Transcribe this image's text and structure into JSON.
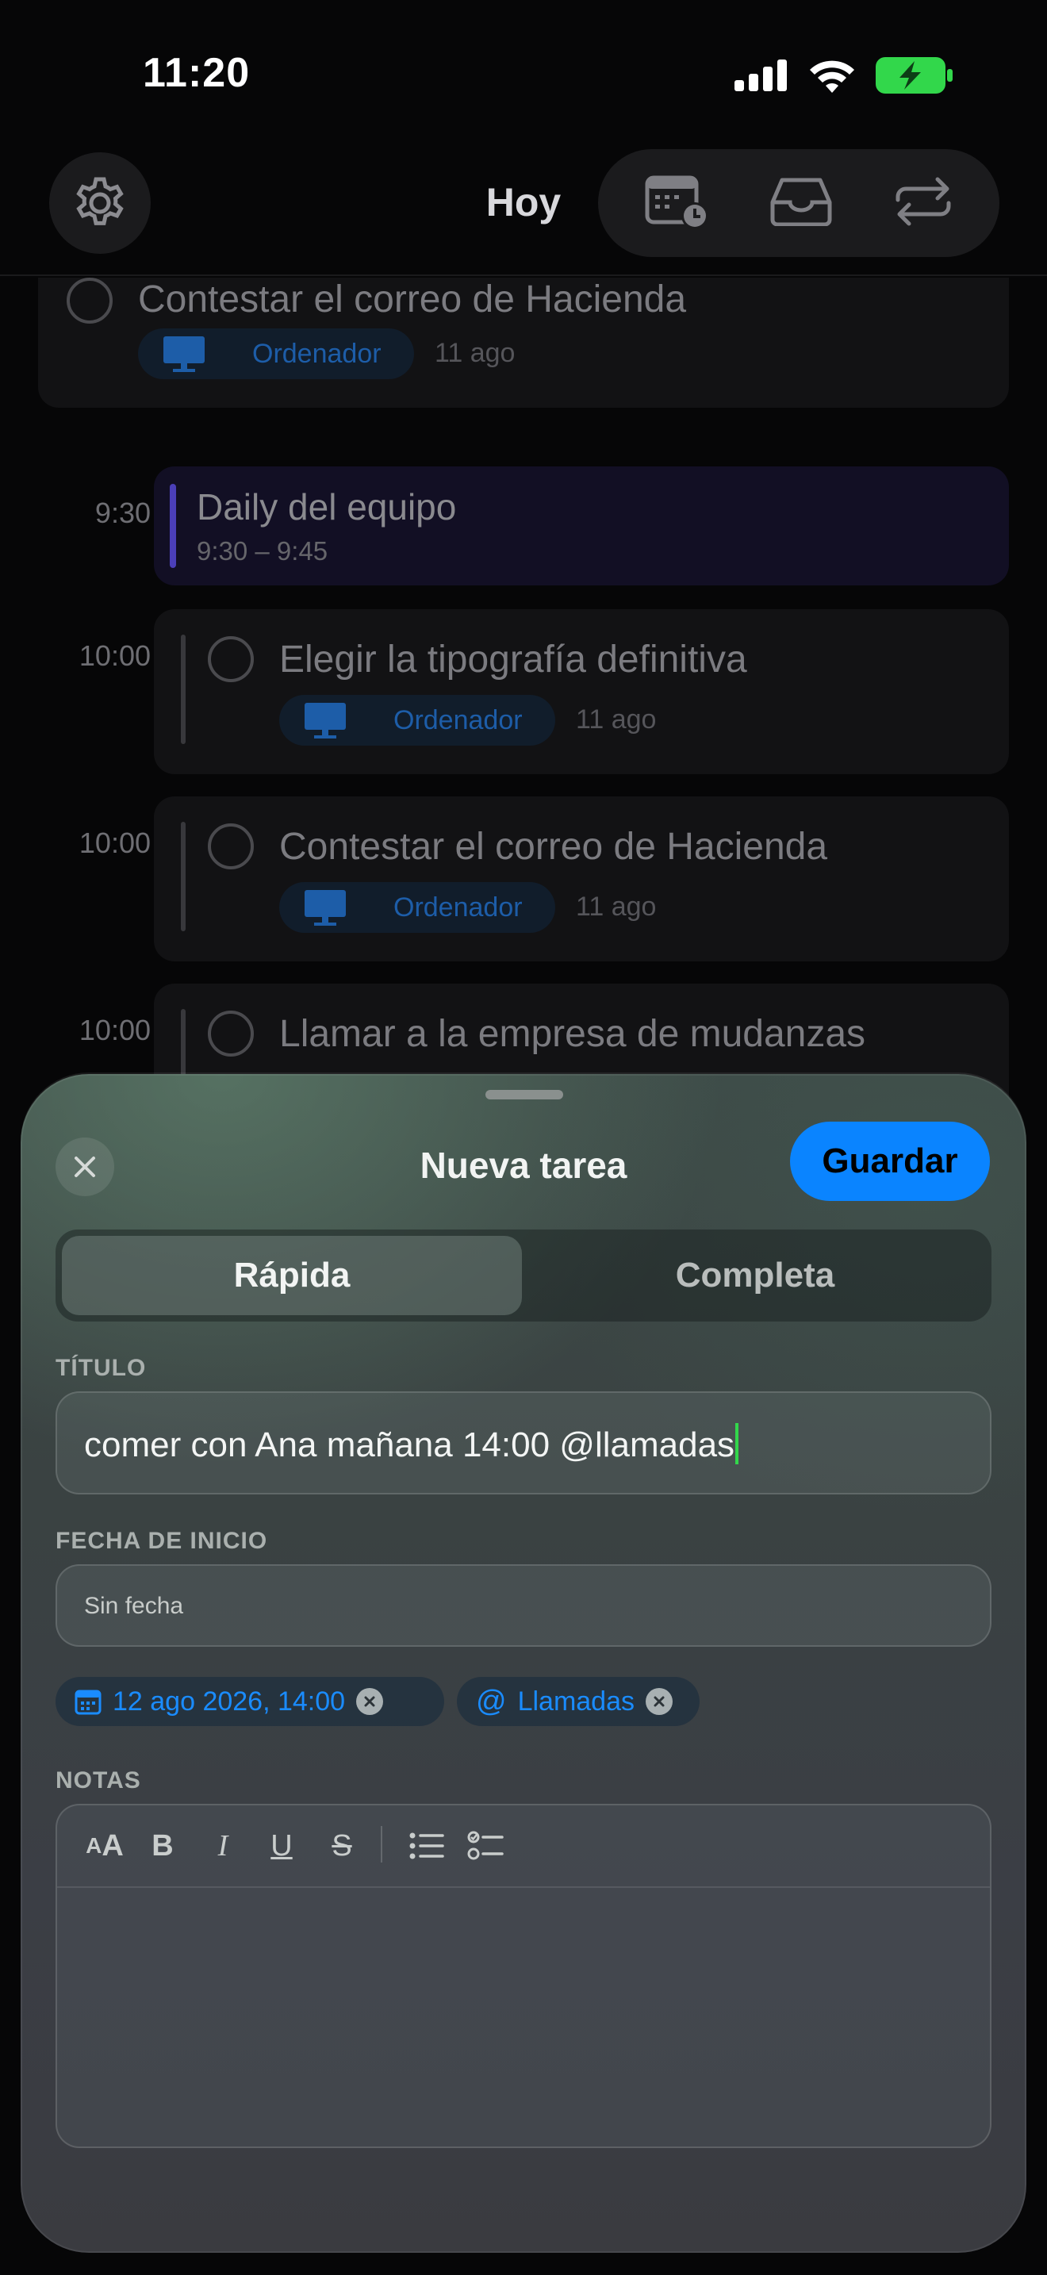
{
  "status_bar": {
    "time": "11:20"
  },
  "nav": {
    "title": "Hoy"
  },
  "list": {
    "top_task": {
      "title": "Contestar el correo de Hacienda",
      "tag": "Ordenador",
      "date": "11 ago"
    },
    "event": {
      "time": "9:30",
      "title": "Daily del equipo",
      "range": "9:30 – 9:45"
    },
    "tasks": [
      {
        "time": "10:00",
        "title": "Elegir la tipografía definitiva",
        "tag": "Ordenador",
        "date": "11 ago"
      },
      {
        "time": "10:00",
        "title": "Contestar el correo de Hacienda",
        "tag": "Ordenador",
        "date": "11 ago"
      },
      {
        "time": "10:00",
        "title": "Llamar a la empresa de mudanzas"
      }
    ]
  },
  "sheet": {
    "title": "Nueva tarea",
    "save_label": "Guardar",
    "segments": {
      "active": "Rápida",
      "inactive": "Completa"
    },
    "title_label": "TÍTULO",
    "title_value": "comer con Ana mañana 14:00 @llamadas",
    "date_label": "FECHA DE INICIO",
    "date_placeholder": "Sin fecha",
    "tokens": {
      "date": "12 ago 2026, 14:00",
      "context": "Llamadas"
    },
    "notes_label": "NOTAS",
    "toolbar": {
      "text_size": "AA",
      "bold": "B",
      "italic": "I",
      "underline": "U",
      "strike": "S"
    }
  },
  "colors": {
    "accent": "#0a84ff",
    "event_bar": "#4b3fb8",
    "caret": "#32d74b",
    "battery": "#32d74b"
  }
}
